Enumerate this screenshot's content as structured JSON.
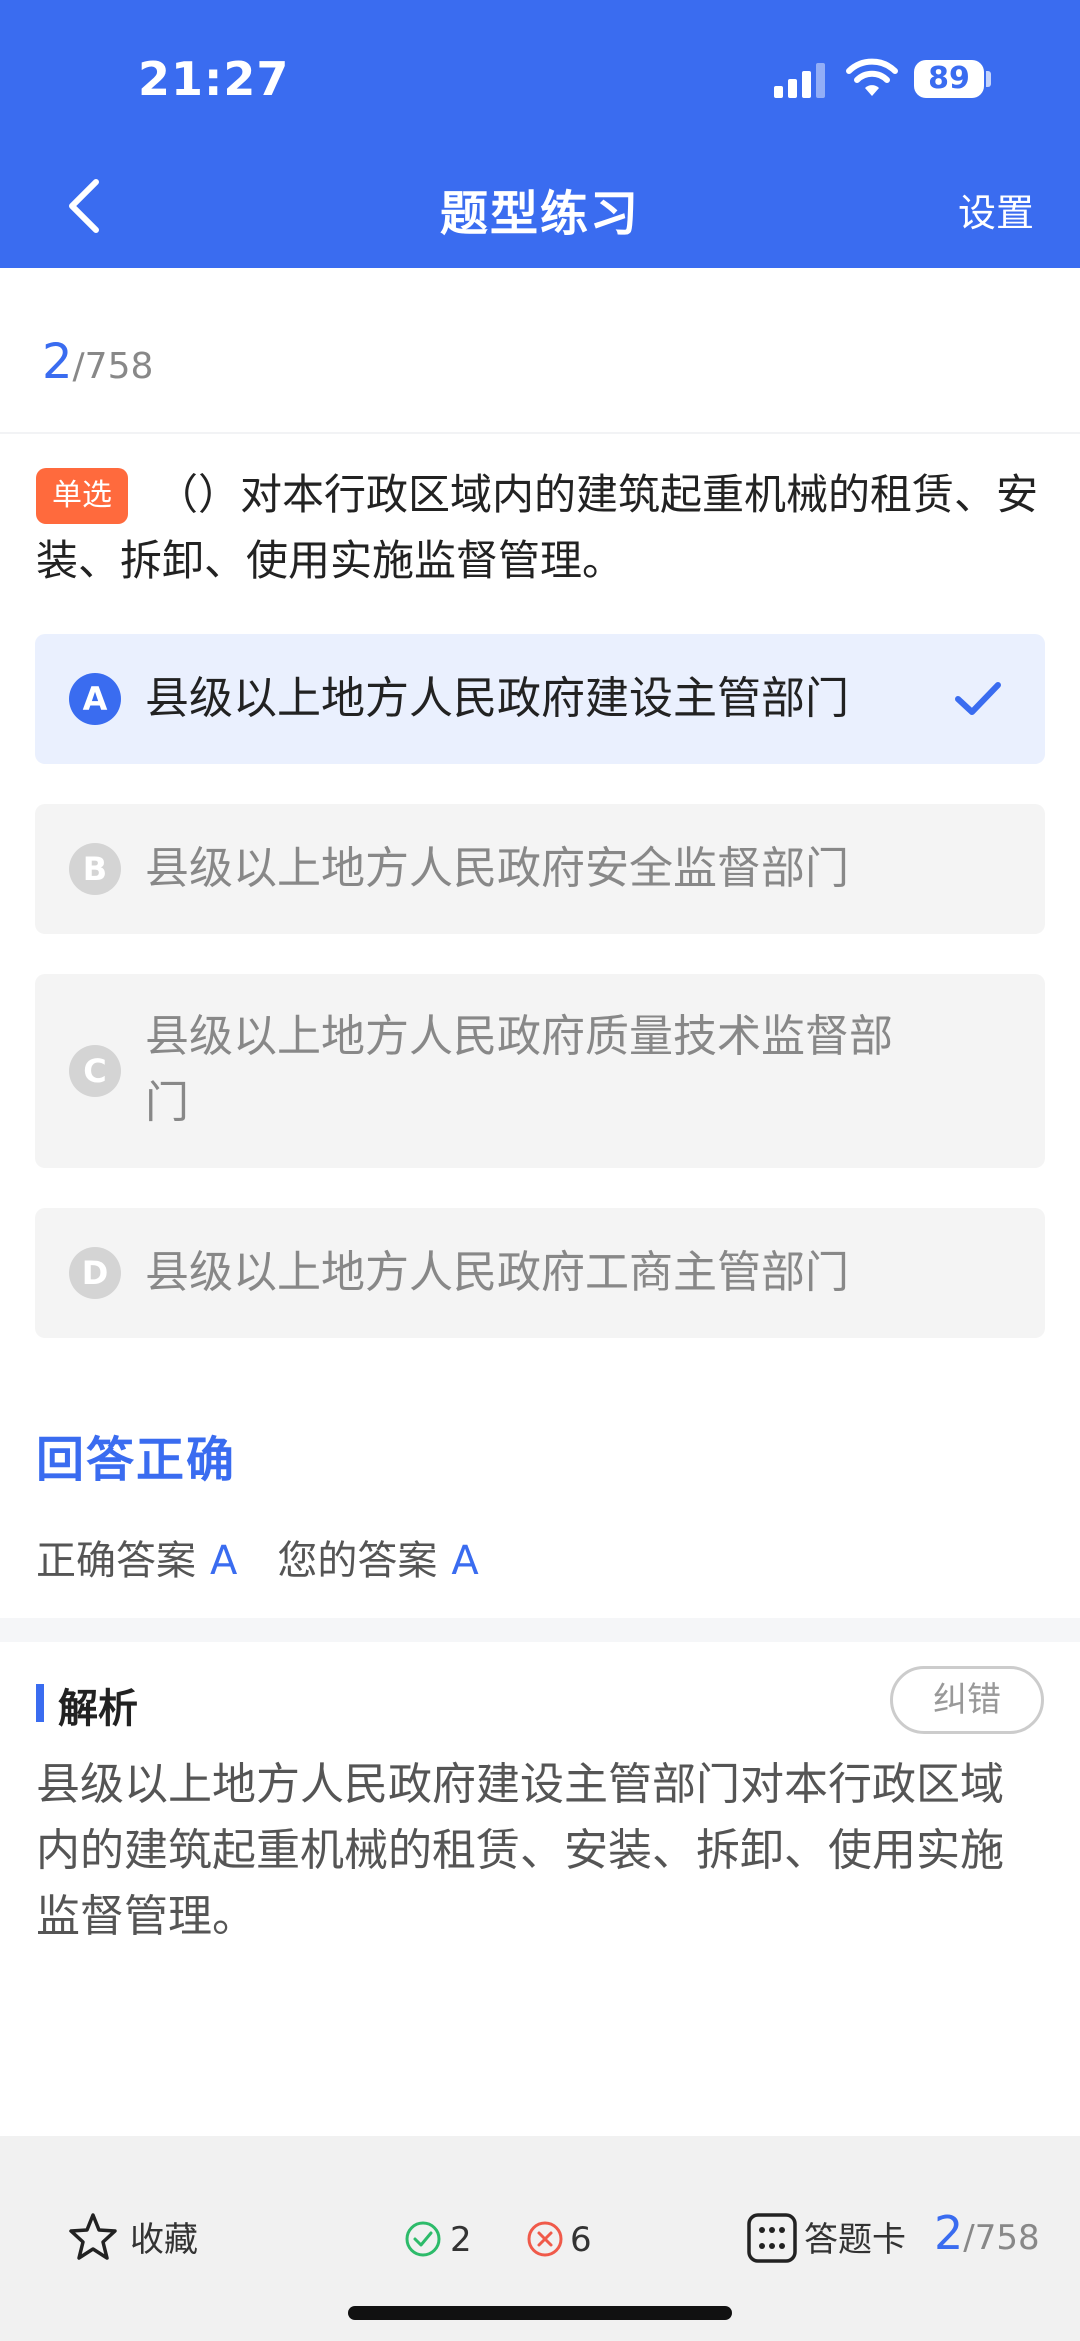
{
  "status_bar": {
    "time": "21:27",
    "battery": "89"
  },
  "header": {
    "title": "题型练习",
    "settings_label": "设置"
  },
  "progress": {
    "current": "2",
    "total": "/758"
  },
  "question": {
    "type_badge": "单选",
    "text": "（）对本行政区域内的建筑起重机械的租赁、安装、拆卸、使用实施监督管理。"
  },
  "options": [
    {
      "letter": "A",
      "text": "县级以上地方人民政府建设主管部门",
      "selected": true
    },
    {
      "letter": "B",
      "text": "县级以上地方人民政府安全监督部门",
      "selected": false
    },
    {
      "letter": "C",
      "text": "县级以上地方人民政府质量技术监督部门",
      "selected": false
    },
    {
      "letter": "D",
      "text": "县级以上地方人民政府工商主管部门",
      "selected": false
    }
  ],
  "result": {
    "title": "回答正确",
    "correct_label": "正确答案",
    "correct_value": "A",
    "yours_label": "您的答案",
    "yours_value": "A"
  },
  "analysis": {
    "title": "解析",
    "report_label": "纠错",
    "text": "县级以上地方人民政府建设主管部门对本行政区域内的建筑起重机械的租赁、安装、拆卸、使用实施监督管理。"
  },
  "bottom_bar": {
    "favorite_label": "收藏",
    "correct_count": "2",
    "wrong_count": "6",
    "answer_card_label": "答题卡",
    "progress_current": "2",
    "progress_total": "/758"
  },
  "colors": {
    "accent": "#3a6cf0",
    "badge": "#ff6a3d",
    "correct": "#2dbb6a",
    "wrong": "#f05a4a"
  }
}
